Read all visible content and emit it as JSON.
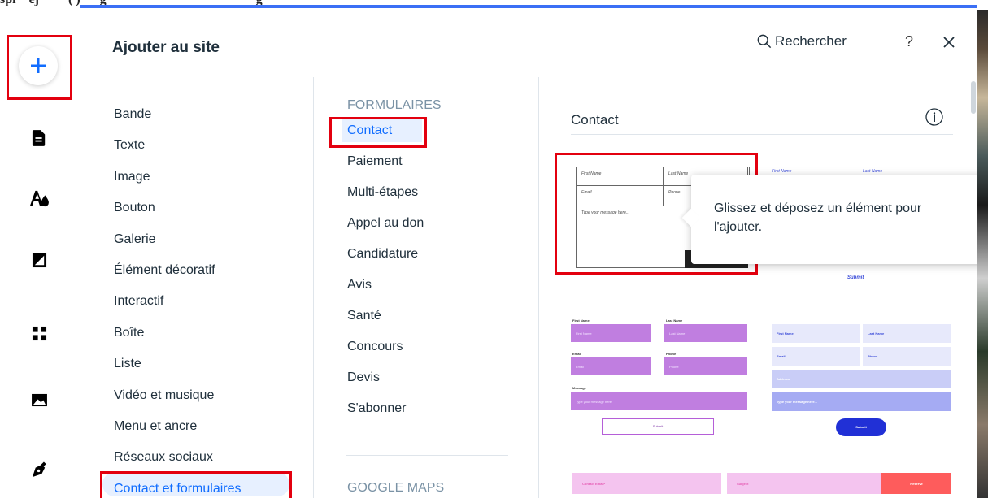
{
  "background_page": {
    "top_text": "spi    ej         ( )      g                                              g"
  },
  "toolbar": {
    "add_icon": "plus-icon",
    "icons": [
      "pages-icon",
      "design-icon",
      "background-icon",
      "apps-icon",
      "media-icon",
      "blog-pen-icon"
    ]
  },
  "panel": {
    "title": "Ajouter au site",
    "search_label": "Rechercher",
    "help_label": "?",
    "close_icon": "close-icon"
  },
  "categories": [
    {
      "label": "Bande"
    },
    {
      "label": "Texte"
    },
    {
      "label": "Image"
    },
    {
      "label": "Bouton"
    },
    {
      "label": "Galerie"
    },
    {
      "label": "Élément décoratif"
    },
    {
      "label": "Interactif"
    },
    {
      "label": "Boîte"
    },
    {
      "label": "Liste"
    },
    {
      "label": "Vidéo et musique"
    },
    {
      "label": "Menu et ancre"
    },
    {
      "label": "Réseaux sociaux"
    },
    {
      "label": "Contact et formulaires"
    }
  ],
  "subcategories": {
    "section1_title": "FORMULAIRES",
    "items": [
      {
        "label": "Contact"
      },
      {
        "label": "Paiement"
      },
      {
        "label": "Multi-étapes"
      },
      {
        "label": "Appel au don"
      },
      {
        "label": "Candidature"
      },
      {
        "label": "Avis"
      },
      {
        "label": "Santé"
      },
      {
        "label": "Concours"
      },
      {
        "label": "Devis"
      },
      {
        "label": "S'abonner"
      }
    ],
    "section2_title": "GOOGLE MAPS"
  },
  "preview": {
    "title": "Contact",
    "tooltip": "Glissez et déposez un élément pour l'ajouter.",
    "form1": {
      "first_name": "First Name",
      "last_name": "Last Name",
      "email": "Email",
      "phone": "Phone",
      "message": "Type your message here..."
    },
    "form2": {
      "first_name": "First Name",
      "last_name": "Last Name",
      "submit": "Submit"
    },
    "form3": {
      "first_name": "First Name",
      "last_name": "Last Name",
      "email": "Email",
      "phone": "Phone",
      "message": "Message",
      "message_placeholder": "Type your message here",
      "submit": "Submit"
    },
    "form4": {
      "first_name": "First Name",
      "last_name": "Last Name",
      "email": "Email",
      "phone": "Phone",
      "address": "Address",
      "message": "Type your message here...",
      "submit": "Submit"
    },
    "form5": {
      "email": "Contact Email*",
      "subject": "Subject",
      "button": "Reserve"
    }
  },
  "colors": {
    "accent": "#116dff",
    "highlight": "#e3000f",
    "form3_field": "#c07ee0",
    "form4_submit": "#2130d6",
    "form5_button": "#fe5c5c"
  }
}
